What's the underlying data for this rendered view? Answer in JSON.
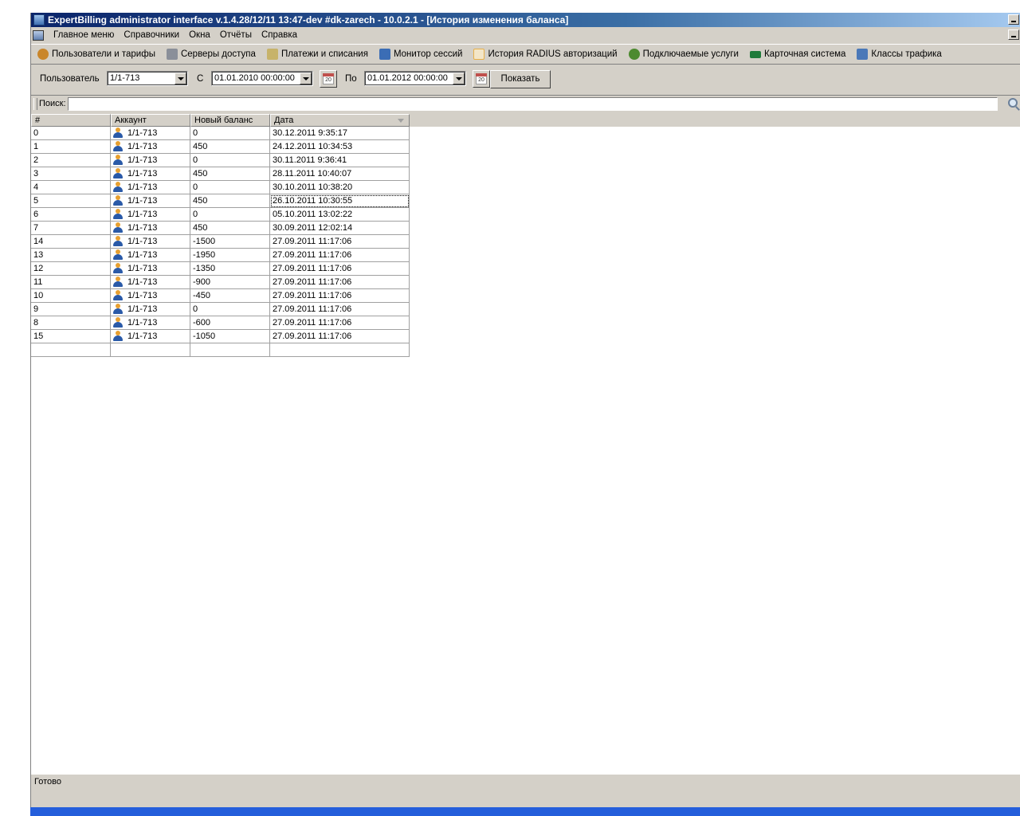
{
  "window": {
    "title": "ExpertBilling administrator interface v.1.4.28/12/11 13:47-dev #dk-zarech - 10.0.2.1 - [История изменения баланса]"
  },
  "menu": [
    "Главное меню",
    "Справочники",
    "Окна",
    "Отчёты",
    "Справка"
  ],
  "toolbar": [
    {
      "label": "Пользователи и тарифы",
      "icon": "users-icon",
      "color": "#c9862b"
    },
    {
      "label": "Серверы доступа",
      "icon": "server-icon",
      "color": "#8a8f99"
    },
    {
      "label": "Платежи и списания",
      "icon": "payments-icon",
      "color": "#c7b36a"
    },
    {
      "label": "Монитор сессий",
      "icon": "monitor-icon",
      "color": "#3b6db5"
    },
    {
      "label": "История RADIUS авторизаций",
      "icon": "history-icon",
      "color": "#e8b04a"
    },
    {
      "label": "Подключаемые услуги",
      "icon": "services-icon",
      "color": "#4c8a2f"
    },
    {
      "label": "Карточная система",
      "icon": "card-icon",
      "color": "#1f7a3a"
    },
    {
      "label": "Классы трафика",
      "icon": "traffic-icon",
      "color": "#4a78b8"
    }
  ],
  "filter": {
    "user_label": "Пользователь",
    "user_value": "1/1-713",
    "from_label": "С",
    "from_value": "01.01.2010 00:00:00",
    "to_label": "По",
    "to_value": "01.01.2012 00:00:00",
    "calendar_text": "20",
    "show_button": "Показать"
  },
  "search": {
    "label": "Поиск:",
    "value": ""
  },
  "table": {
    "columns": [
      "#",
      "Аккаунт",
      "Новый баланс",
      "Дата"
    ],
    "rows": [
      {
        "id": "0",
        "account": "1/1-713",
        "balance": "0",
        "date": "30.12.2011 9:35:17"
      },
      {
        "id": "1",
        "account": "1/1-713",
        "balance": "450",
        "date": "24.12.2011 10:34:53"
      },
      {
        "id": "2",
        "account": "1/1-713",
        "balance": "0",
        "date": "30.11.2011 9:36:41"
      },
      {
        "id": "3",
        "account": "1/1-713",
        "balance": "450",
        "date": "28.11.2011 10:40:07"
      },
      {
        "id": "4",
        "account": "1/1-713",
        "balance": "0",
        "date": "30.10.2011 10:38:20"
      },
      {
        "id": "5",
        "account": "1/1-713",
        "balance": "450",
        "date": "26.10.2011 10:30:55"
      },
      {
        "id": "6",
        "account": "1/1-713",
        "balance": "0",
        "date": "05.10.2011 13:02:22"
      },
      {
        "id": "7",
        "account": "1/1-713",
        "balance": "450",
        "date": "30.09.2011 12:02:14"
      },
      {
        "id": "14",
        "account": "1/1-713",
        "balance": "-1500",
        "date": "27.09.2011 11:17:06"
      },
      {
        "id": "13",
        "account": "1/1-713",
        "balance": "-1950",
        "date": "27.09.2011 11:17:06"
      },
      {
        "id": "12",
        "account": "1/1-713",
        "balance": "-1350",
        "date": "27.09.2011 11:17:06"
      },
      {
        "id": "11",
        "account": "1/1-713",
        "balance": "-900",
        "date": "27.09.2011 11:17:06"
      },
      {
        "id": "10",
        "account": "1/1-713",
        "balance": "-450",
        "date": "27.09.2011 11:17:06"
      },
      {
        "id": "9",
        "account": "1/1-713",
        "balance": "0",
        "date": "27.09.2011 11:17:06"
      },
      {
        "id": "8",
        "account": "1/1-713",
        "balance": "-600",
        "date": "27.09.2011 11:17:06"
      },
      {
        "id": "15",
        "account": "1/1-713",
        "balance": "-1050",
        "date": "27.09.2011 11:17:06"
      }
    ]
  },
  "status": {
    "text": "Готово"
  }
}
